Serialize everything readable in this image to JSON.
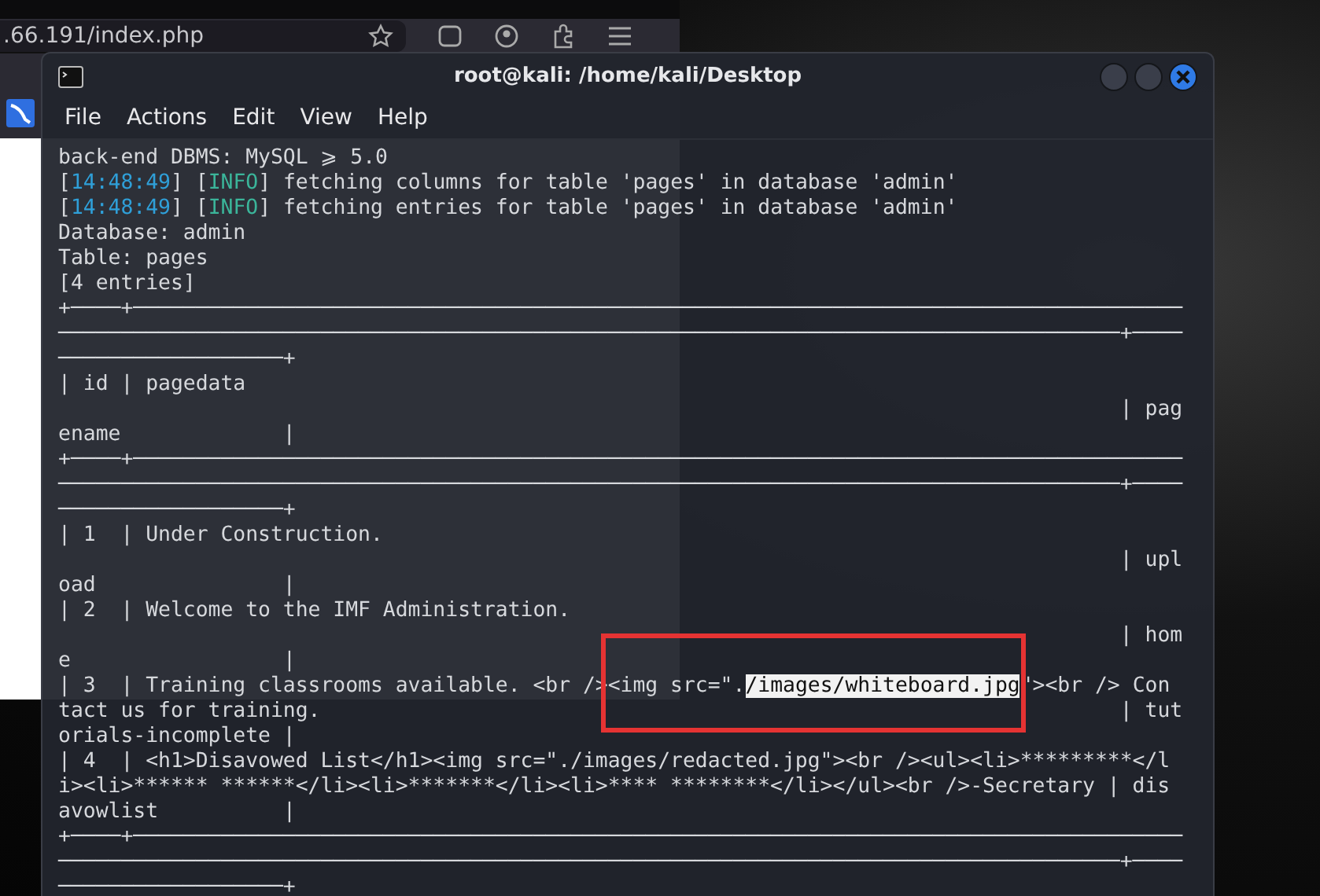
{
  "browser": {
    "url": ".66.191/index.php"
  },
  "terminal": {
    "title": "root@kali: /home/kali/Desktop",
    "menu": [
      "File",
      "Actions",
      "Edit",
      "View",
      "Help"
    ],
    "lines": [
      [
        {
          "kind": "plain",
          "text": "back-end DBMS: MySQL ⩾ 5.0"
        }
      ],
      [
        {
          "kind": "plain",
          "text": "["
        },
        {
          "kind": "time",
          "text": "14:48:49"
        },
        {
          "kind": "plain",
          "text": "] ["
        },
        {
          "kind": "info",
          "text": "INFO"
        },
        {
          "kind": "plain",
          "text": "] fetching columns for table 'pages' in database 'admin'"
        }
      ],
      [
        {
          "kind": "plain",
          "text": "["
        },
        {
          "kind": "time",
          "text": "14:48:49"
        },
        {
          "kind": "plain",
          "text": "] ["
        },
        {
          "kind": "info",
          "text": "INFO"
        },
        {
          "kind": "plain",
          "text": "] fetching entries for table 'pages' in database 'admin'"
        }
      ],
      [
        {
          "kind": "plain",
          "text": "Database: admin"
        }
      ],
      [
        {
          "kind": "plain",
          "text": "Table: pages"
        }
      ],
      [
        {
          "kind": "plain",
          "text": "[4 entries]"
        }
      ],
      [
        {
          "kind": "plain",
          "text": "+────+────────────────────────────────────────────────────────────────────────────────────"
        }
      ],
      [
        {
          "kind": "plain",
          "text": "─────────────────────────────────────────────────────────────────────────────────────+────"
        }
      ],
      [
        {
          "kind": "plain",
          "text": "──────────────────+"
        }
      ],
      [
        {
          "kind": "plain",
          "text": "| id | pagedata"
        }
      ],
      [
        {
          "kind": "plain",
          "text": "                                                                                     | pag"
        }
      ],
      [
        {
          "kind": "plain",
          "text": "ename             |"
        }
      ],
      [
        {
          "kind": "plain",
          "text": "+────+────────────────────────────────────────────────────────────────────────────────────"
        }
      ],
      [
        {
          "kind": "plain",
          "text": "─────────────────────────────────────────────────────────────────────────────────────+────"
        }
      ],
      [
        {
          "kind": "plain",
          "text": "──────────────────+"
        }
      ],
      [
        {
          "kind": "plain",
          "text": "| 1  | Under Construction."
        }
      ],
      [
        {
          "kind": "plain",
          "text": "                                                                                     | upl"
        }
      ],
      [
        {
          "kind": "plain",
          "text": "oad               |"
        }
      ],
      [
        {
          "kind": "plain",
          "text": "| 2  | Welcome to the IMF Administration."
        }
      ],
      [
        {
          "kind": "plain",
          "text": "                                                                                     | hom"
        }
      ],
      [
        {
          "kind": "plain",
          "text": "e                 |"
        }
      ],
      [
        {
          "kind": "plain",
          "text": "| 3  | Training classrooms available. <br /><img src=\"."
        },
        {
          "kind": "selected",
          "text": "/images/whiteboard.jpg"
        },
        {
          "kind": "plain",
          "text": "\"><br /> Con"
        }
      ],
      [
        {
          "kind": "plain",
          "text": "tact us for training.                                                                | tut"
        }
      ],
      [
        {
          "kind": "plain",
          "text": "orials-incomplete |"
        }
      ],
      [
        {
          "kind": "plain",
          "text": "| 4  | <h1>Disavowed List</h1><img src=\"./images/redacted.jpg\"><br /><ul><li>*********</l"
        }
      ],
      [
        {
          "kind": "plain",
          "text": "i><li>****** ******</li><li>*******</li><li>**** ********</li></ul><br />-Secretary | dis"
        }
      ],
      [
        {
          "kind": "plain",
          "text": "avowlist          |"
        }
      ],
      [
        {
          "kind": "plain",
          "text": "+────+────────────────────────────────────────────────────────────────────────────────────"
        }
      ],
      [
        {
          "kind": "plain",
          "text": "─────────────────────────────────────────────────────────────────────────────────────+────"
        }
      ],
      [
        {
          "kind": "plain",
          "text": "──────────────────+"
        }
      ]
    ]
  }
}
